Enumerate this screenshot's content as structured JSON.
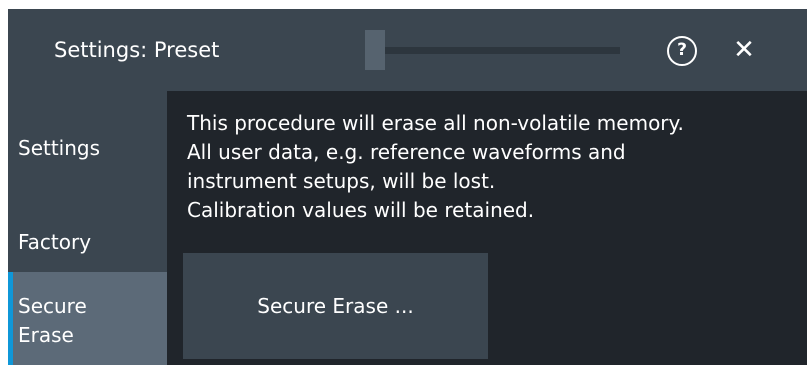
{
  "dialog": {
    "title": "Settings: Preset",
    "help_label": "?",
    "close_label": "✕"
  },
  "sidebar": {
    "items": [
      {
        "label": "Settings",
        "selected": false
      },
      {
        "label": "Factory",
        "selected": false
      },
      {
        "label": "Secure\nErase",
        "selected": true
      }
    ]
  },
  "content": {
    "description_lines": [
      "This procedure will erase all non-volatile memory.",
      "All user data, e.g. reference waveforms and",
      "instrument setups, will be lost.",
      "Calibration values will be retained."
    ],
    "erase_button_label": "Secure Erase ..."
  },
  "colors": {
    "background": "#20252b",
    "panel": "#3b4650",
    "selected": "#5c6a78",
    "accent": "#0f97d8",
    "text": "#ffffff"
  },
  "icons": {
    "help": "help-circle-icon",
    "close": "close-icon"
  }
}
